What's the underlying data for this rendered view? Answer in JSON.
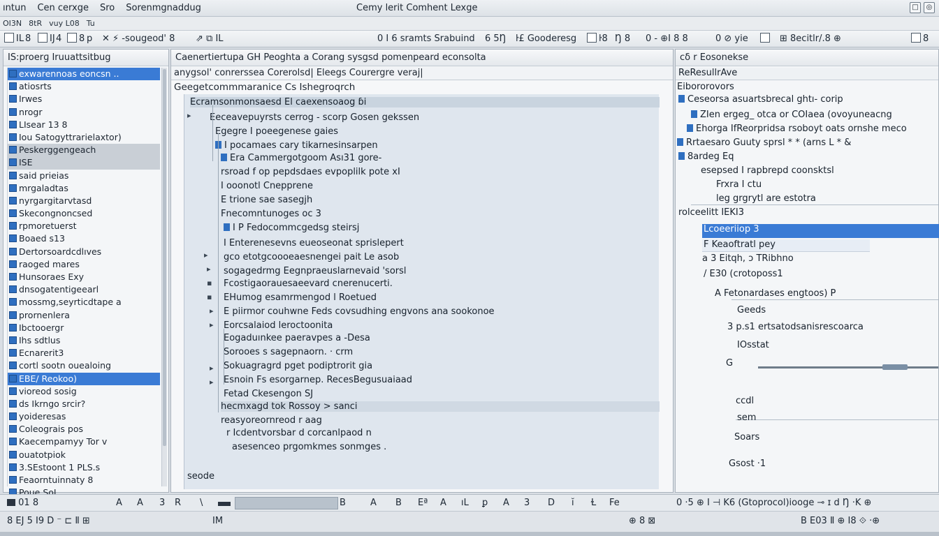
{
  "titlebar": {
    "menu": [
      "ıntun",
      "Cen cerxge",
      "Sro",
      "Sorenmgnaddug"
    ],
    "title": "Cemy lerit Comhent Lexge",
    "win_buttons": [
      "□",
      "◎"
    ]
  },
  "toolbar": {
    "items": [
      "OI3N",
      "8tR",
      "vuy L08",
      "Tu"
    ]
  },
  "ribbon": {
    "left": [
      "IL",
      "8",
      "IJ",
      "4",
      "8",
      "p"
    ],
    "search_label": "✕ ⚡ -sougeod' 8",
    "mid_items": [
      "0 I 6 sramts Srabuind",
      "6 5Ŋ",
      "ŀ£ Gooderesg",
      "ŀ8",
      "Ŋ 8",
      "0 - ⊕I 8 8"
    ],
    "right_items": [
      "0 ⊘ yie",
      "⊞ 8ecitlr/.8 ⊕"
    ],
    "far_right": "8"
  },
  "left": {
    "header": "IS:proerɡ  Iruuattsitbug",
    "items": [
      {
        "label": "exwarennoas eoncsn ..",
        "state": "sel"
      },
      {
        "label": "atiosrts",
        "state": ""
      },
      {
        "label": "Irwes",
        "state": ""
      },
      {
        "label": "nrogr",
        "state": ""
      },
      {
        "label": "LIsear  13  8",
        "state": ""
      },
      {
        "label": "Iou Satogyttrarielaxtor)",
        "state": ""
      },
      {
        "label": "Peskerggengeach",
        "state": "gray"
      },
      {
        "label": "ISE",
        "state": "gray"
      },
      {
        "label": "said prieias",
        "state": ""
      },
      {
        "label": "mrgaladtas",
        "state": ""
      },
      {
        "label": "nyrgargitarvtasd",
        "state": ""
      },
      {
        "label": "Skecongnoncsed",
        "state": ""
      },
      {
        "label": "rpmoretuerst",
        "state": ""
      },
      {
        "label": "Boaed  s13",
        "state": ""
      },
      {
        "label": "Dertorsoardcdlıves",
        "state": ""
      },
      {
        "label": "raoged  mares",
        "state": ""
      },
      {
        "label": "Hunsoraes Exy",
        "state": ""
      },
      {
        "label": "dnsogatentigeearl",
        "state": ""
      },
      {
        "label": "mossmg,seyrticdtape a",
        "state": ""
      },
      {
        "label": "prornenlera",
        "state": ""
      },
      {
        "label": "Ibctooergr",
        "state": ""
      },
      {
        "label": "Ihs sdtlus",
        "state": ""
      },
      {
        "label": "Ecnarerit3",
        "state": ""
      },
      {
        "label": "cortl sootn ouealoing",
        "state": ""
      },
      {
        "label": "EBE/ Reokoo)",
        "state": "sel"
      },
      {
        "label": "vioreod  sosig",
        "state": ""
      },
      {
        "label": "ds Ikrngo srcir?",
        "state": ""
      },
      {
        "label": "yoideresas",
        "state": ""
      },
      {
        "label": "Coleograis  pos",
        "state": ""
      },
      {
        "label": "Kaecempamyy Tor v",
        "state": ""
      },
      {
        "label": "ouatotpiok",
        "state": ""
      },
      {
        "label": "3.SEstoont 1 PLS.s",
        "state": ""
      },
      {
        "label": "Feaorntuinnaty  8",
        "state": ""
      },
      {
        "label": "Poue SoI",
        "state": ""
      }
    ]
  },
  "middle": {
    "header": "Caenertiertupa     GH Peoghta  a Corang sysgsd pomenpeard econsolta",
    "subheader": "anygsol' conrerssea Corerolsd| Eleegs Courergre veraj|",
    "title2": "Geegetcommmaranice  Cs Ishegroqrch",
    "lines": [
      {
        "t": "Ecramsonmonsaesd El caexensoaog  ɓi",
        "hl": "hl"
      },
      {
        "t": "Eeceavepuyrsts cerrog - scorp Gosen gekssen",
        "hl": ""
      },
      {
        "t": "Egegre  I poeegenese  gaies",
        "hl": ""
      },
      {
        "t": "I pocamaes  cary  tikarnesinsarpen",
        "hl": ""
      },
      {
        "t": "Era Cammergotgoom Ası31  gore-",
        "hl": ""
      },
      {
        "t": "rsroad  f op pepdsdaes  evpoplilk  pote xI",
        "hl": ""
      },
      {
        "t": "I ooonotl  Cnepprene",
        "hl": ""
      },
      {
        "t": "E trione  sae  sasegjh",
        "hl": ""
      },
      {
        "t": "Fnecomntunoges oc 3",
        "hl": ""
      },
      {
        "t": "I P  Fedocommcgedsg  steirsj",
        "hl": ""
      },
      {
        "t": "I  Enterenesevns  eueoseonat  sprislepert",
        "hl": ""
      },
      {
        "t": "gco etotgcoooeaesnengei pait Le asob",
        "hl": ""
      },
      {
        "t": "sogagedrmg  Eegnpraeuslarnevaid  'sorsl",
        "hl": ""
      },
      {
        "t": "Fcostigaorauesaeevard cnerenucerti.",
        "hl": ""
      },
      {
        "t": "EHumog  esamrmengod l Roetued",
        "hl": ""
      },
      {
        "t": "E piirmor  couhwne  Feds  covsudhing  engvons  ana  sookonoe",
        "hl": ""
      },
      {
        "t": "Eorcsalaiod leroctoonita",
        "hl": ""
      },
      {
        "t": "Eogaduınkee  paeravpes a -Desa",
        "hl": ""
      },
      {
        "t": "Sorooes  s  sagepnaorn. ·  crm",
        "hl": ""
      },
      {
        "t": "Sokuagragrd pget podiptrorit gia",
        "hl": ""
      },
      {
        "t": "Esnoin  Fs esorgarnep.  RecesBegusuaiaad",
        "hl": ""
      },
      {
        "t": "Fetad   Ckesengon               SJ",
        "hl": ""
      },
      {
        "t": "hecmxagd tok Rossoy > sanci",
        "hl": "hl2"
      },
      {
        "t": "reasyoreornreod r aag",
        "hl": ""
      },
      {
        "t": "r  Icdentvorsbar  d  corcanlpaod n",
        "hl": ""
      },
      {
        "t": "asesenceo  prgomkmes  sonmges .",
        "hl": ""
      },
      {
        "t": "seode",
        "hl": ""
      }
    ]
  },
  "right": {
    "header": "cδ  r Eosonekse",
    "subheader": "ReResullrAve",
    "lines": [
      "Eibororovors",
      "Ceseorsa  asuartsbrecal ghtı-  corip",
      "ZIen ergeg_  otca  or  COIaea (ovoyuneacng",
      "Ehorga  IfReorpridsa rsoboyt oats  ornshe  meco",
      "Rrtaesaro   Guuty  sprsl  *  *  (arns L  *  &",
      "8ardeg  Eq",
      "esepsed I rapbrepd coonsktsl",
      "Frxra I ctu",
      "leg grgrytl  are  estotra",
      "rolceelitt  IEKI3",
      "Lcoeeriiop 3",
      "F Keaoftratl pey",
      "a  3 Eitqh,  ɔ TRibhno",
      "/  E30  (crotoposs1",
      "A   Fetonardases  engtoos)  P",
      "Geeds",
      "3 p.s1  ertsatodsanisrescoarca",
      "IOsstat",
      "G",
      "ccdl",
      "sem",
      "Soars",
      "Gsost  ·1"
    ]
  },
  "bottom1": {
    "items": [
      "01  8",
      "A",
      "A",
      "3",
      "R",
      "\\",
      "B",
      "A",
      "B",
      "Eª",
      "A",
      "ıL",
      "ꝑ",
      "A",
      "3",
      "D",
      "ĭ",
      "Ɫ",
      "Fe",
      "0 ·5  ⊕ I  ⊣  K6  (Gtoprocol)iooge   ⊸ ɪ d  Ŋ  ·K  ⊕"
    ]
  },
  "bottom2": {
    "items": [
      "8 EJ 5 I9 D ⁻ ⊏  Ⅱ ⊞",
      "IM",
      "⊕ 8 ⊠",
      "B E03  Ⅱ ⊕ I8  ⟐ ·⊕"
    ]
  }
}
